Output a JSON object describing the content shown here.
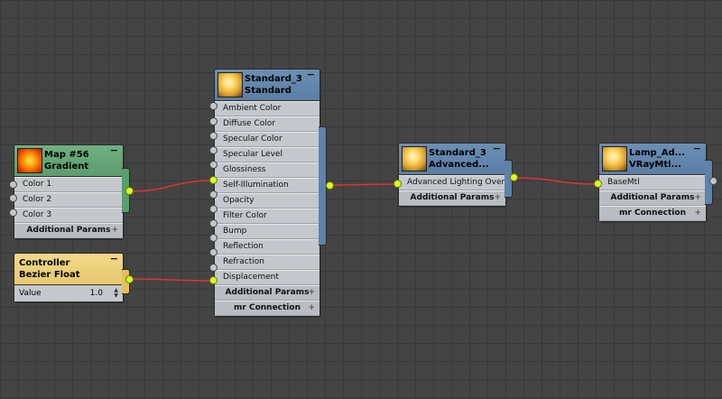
{
  "nodes": {
    "gradient": {
      "title_line1": "Map #56",
      "title_line2": "Gradient",
      "collapse": "−",
      "slots": [
        "Color 1",
        "Color 2",
        "Color 3"
      ],
      "sub": "Additional Params",
      "plus": "+"
    },
    "controller": {
      "title_line1": "Controller",
      "title_line2": "Bezier Float",
      "collapse": "−",
      "value_label": "Value",
      "value": "1.0"
    },
    "standard": {
      "title_line1": "Standard_3",
      "title_line2": "Standard",
      "collapse": "−",
      "slots": [
        "Ambient Color",
        "Diffuse Color",
        "Specular Color",
        "Specular Level",
        "Glossiness",
        "Self-Illumination",
        "Opacity",
        "Filter Color",
        "Bump",
        "Reflection",
        "Refraction",
        "Displacement"
      ],
      "sub1": "Additional Params",
      "sub2": "mr Connection",
      "plus": "+"
    },
    "advanced": {
      "title_line1": "Standard_3",
      "title_line2": "Advanced...",
      "collapse": "−",
      "slot": "Advanced  Lighting  Overri...",
      "sub": "Additional Params",
      "plus": "+"
    },
    "lamp": {
      "title_line1": "Lamp_Ad...",
      "title_line2": "VRayMtl...",
      "collapse": "−",
      "slot": "BaseMtl",
      "sub1": "Additional Params",
      "sub2": "mr Connection",
      "plus": "+"
    }
  },
  "colors": {
    "background": "#444444",
    "wire": "#e03232",
    "socket_active": "#d8ff20"
  }
}
